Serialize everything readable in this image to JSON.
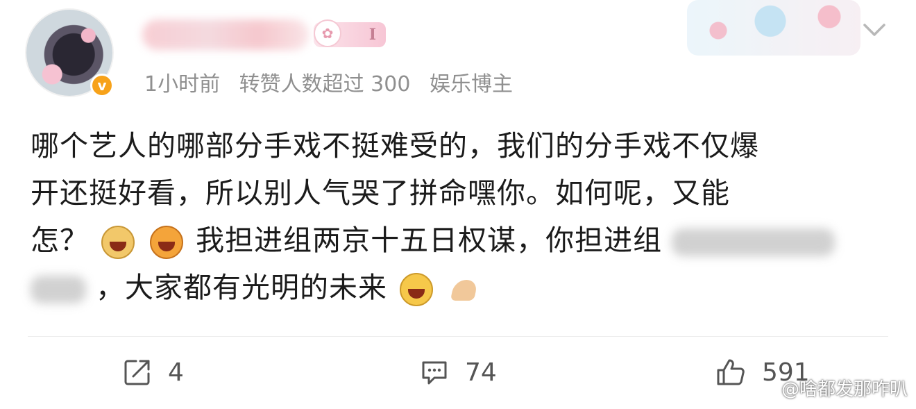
{
  "post": {
    "meta": {
      "time": "1小时前",
      "reposts_label": "转赞人数超过 300",
      "category": "娱乐博主"
    },
    "badge": {
      "level": "I"
    },
    "text": {
      "line1": "哪个艺人的哪部分手戏不挺难受的，我们的分手戏不仅爆",
      "line2": "开还挺好看，所以别人气哭了拼命嘿你。如何呢，又能",
      "line3a": "怎？",
      "line3b": "我担进组两京十五日权谋，你担进组",
      "line4b": "，大家都有光明的未来"
    }
  },
  "actions": {
    "share_count": "4",
    "comment_count": "74",
    "like_count": "591"
  },
  "watermark": "@啥都发那咋叭",
  "icons": [
    "verified-v-icon",
    "bunny-icon",
    "chevron-down-icon",
    "share-icon",
    "comment-icon",
    "thumbs-up-icon",
    "doge-emoji",
    "laugh-emoji",
    "grin-emoji",
    "pray-hands-emoji"
  ],
  "colors": {
    "verified": "#f7a21a",
    "meta_text": "#8f8f8f",
    "body_text": "#1b1b1b"
  }
}
